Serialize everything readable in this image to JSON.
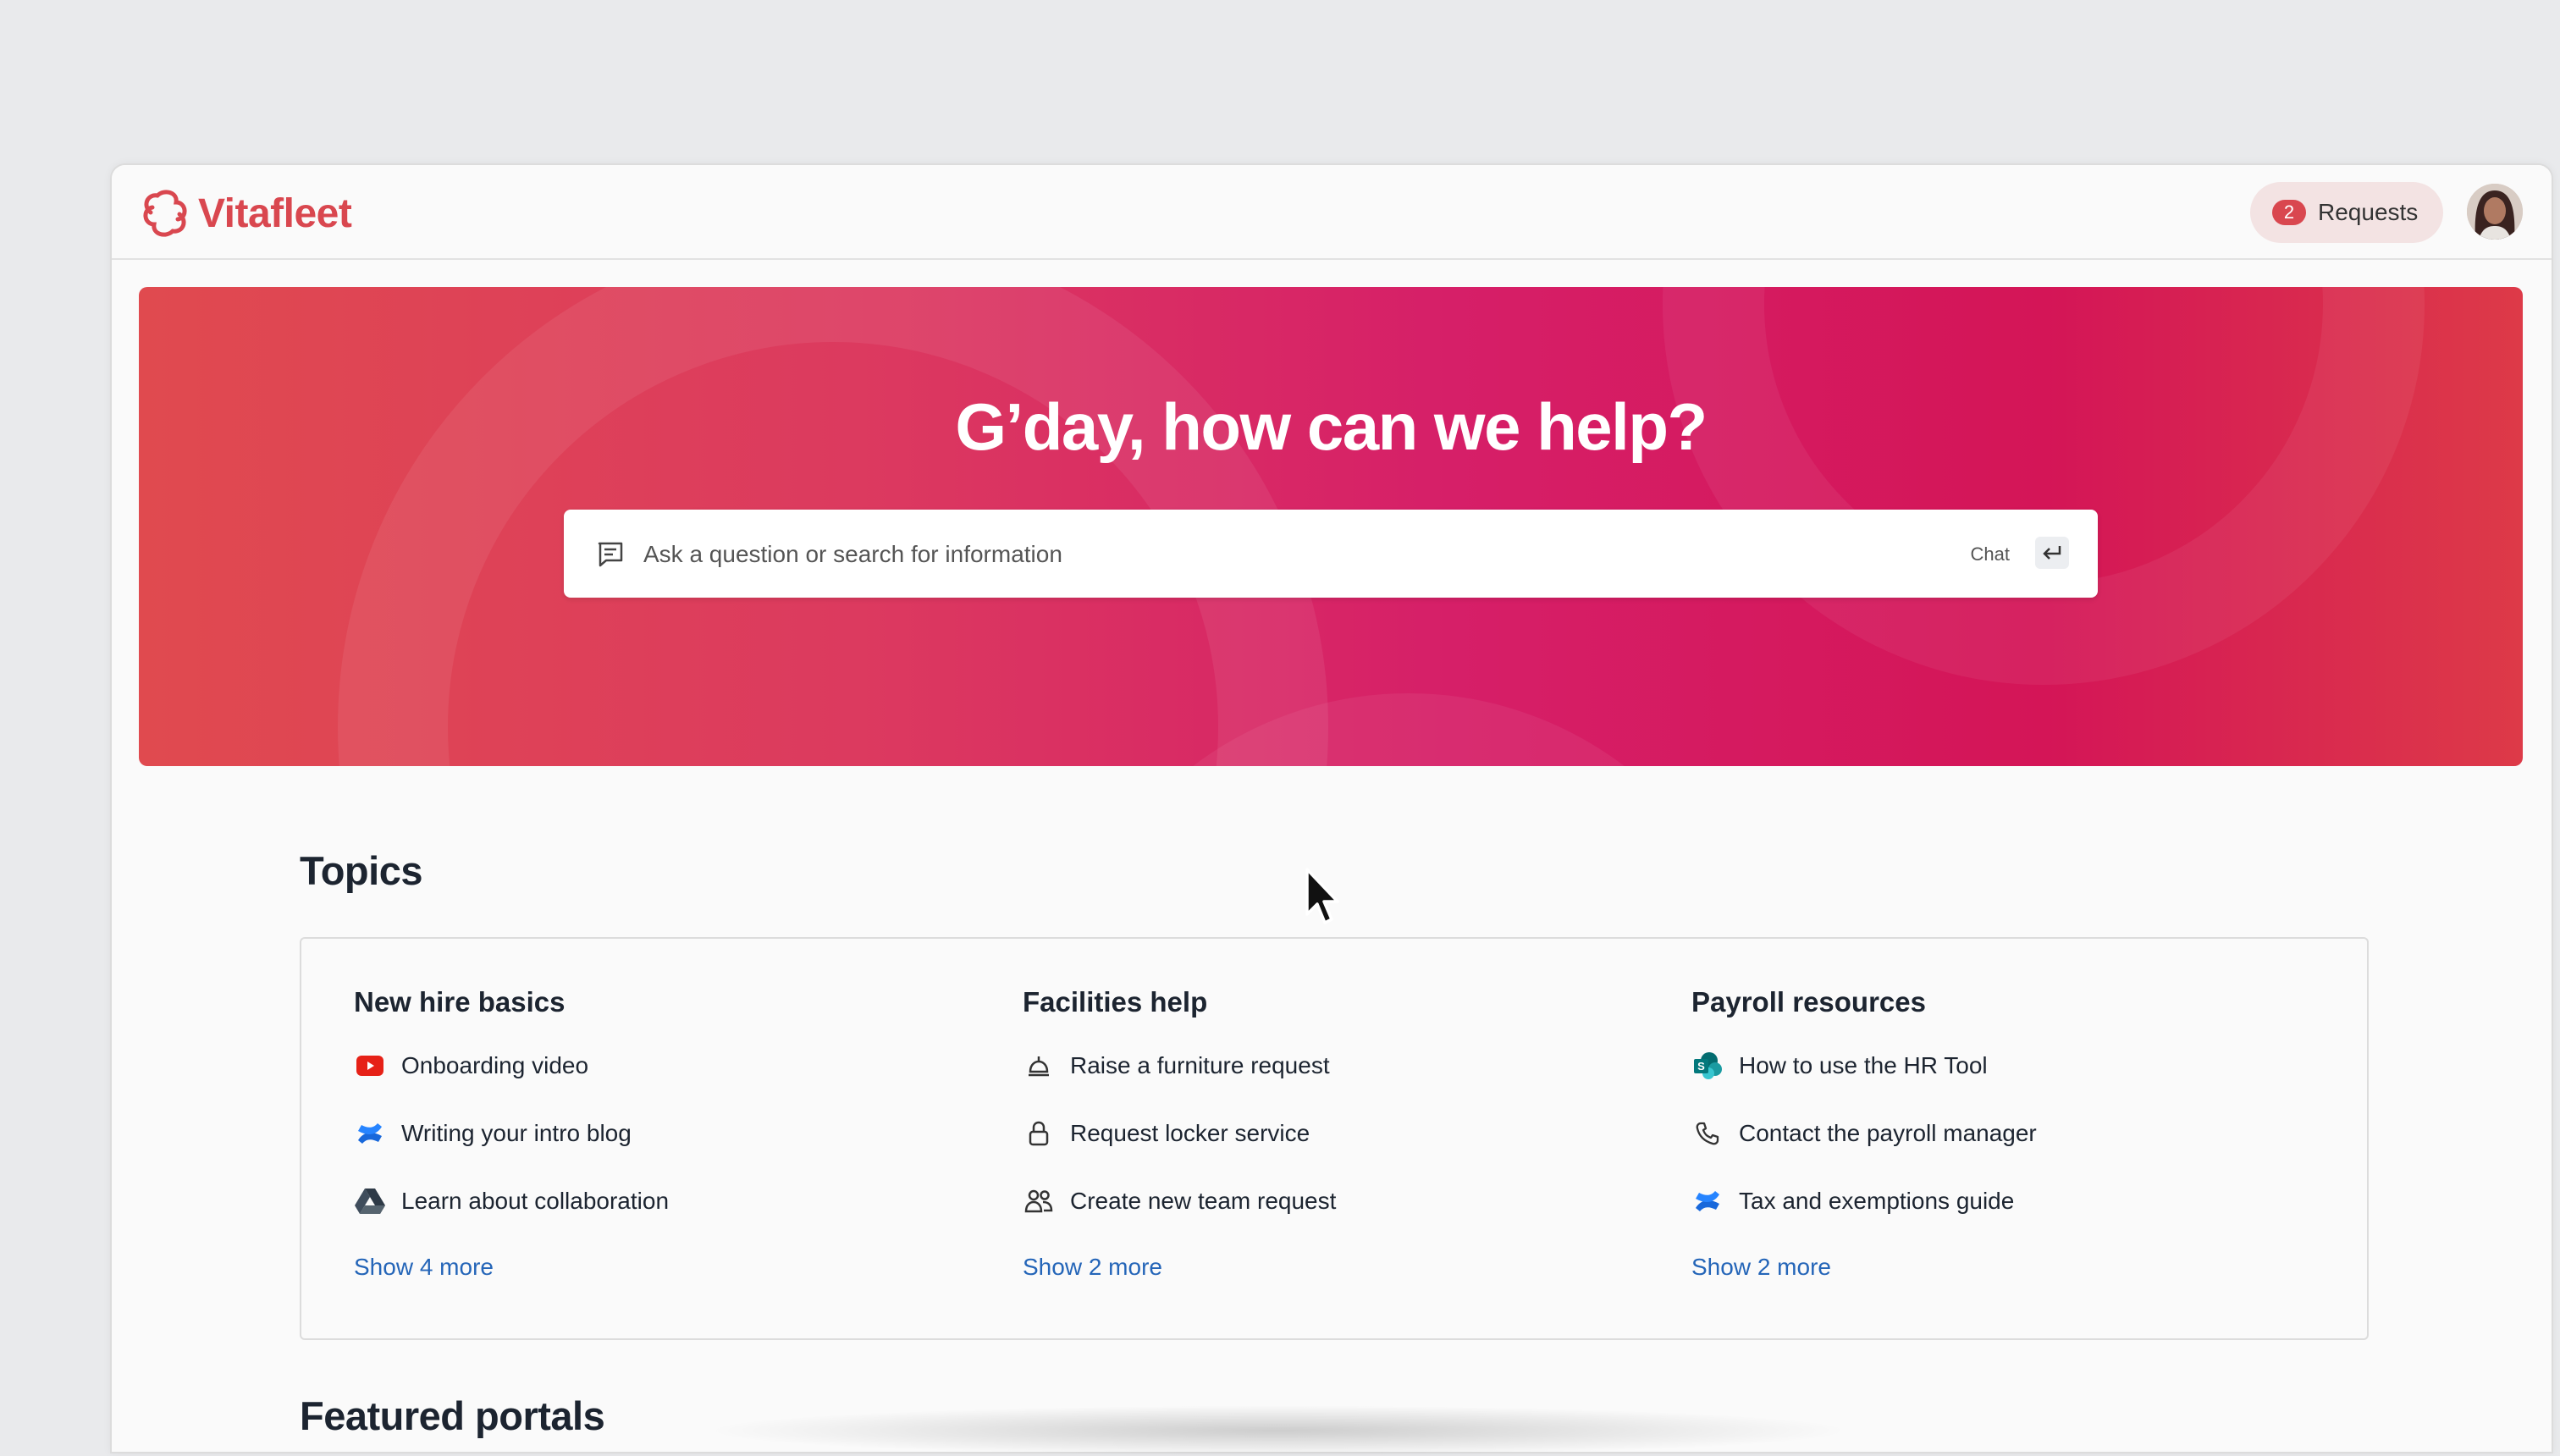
{
  "brand": {
    "name": "Vitafleet",
    "color": "#d9474f",
    "logo_icon": "vitafleet-logo-icon"
  },
  "header": {
    "requests": {
      "count": "2",
      "label": "Requests"
    },
    "avatar_icon": "user-avatar"
  },
  "hero": {
    "title": "G’day, how can we help?",
    "search": {
      "placeholder": "Ask a question or search for information",
      "value": "",
      "chat_label": "Chat",
      "enter_icon": "enter-key-icon"
    },
    "gradient": [
      "#e04a4f",
      "#d61f68",
      "#d41557"
    ]
  },
  "topics": {
    "title": "Topics",
    "columns": [
      {
        "heading": "New hire basics",
        "items": [
          {
            "label": "Onboarding video",
            "icon": "youtube-icon"
          },
          {
            "label": "Writing your intro blog",
            "icon": "confluence-icon"
          },
          {
            "label": "Learn about collaboration",
            "icon": "google-drive-icon"
          }
        ],
        "more": "Show 4 more"
      },
      {
        "heading": "Facilities help",
        "items": [
          {
            "label": "Raise a furniture request",
            "icon": "service-bell-icon"
          },
          {
            "label": "Request locker service",
            "icon": "lock-icon"
          },
          {
            "label": "Create new team request",
            "icon": "people-icon"
          }
        ],
        "more": "Show 2 more"
      },
      {
        "heading": "Payroll resources",
        "items": [
          {
            "label": "How to use the HR Tool",
            "icon": "sharepoint-icon"
          },
          {
            "label": "Contact the payroll manager",
            "icon": "phone-icon"
          },
          {
            "label": "Tax and exemptions guide",
            "icon": "confluence-icon"
          }
        ],
        "more": "Show 2 more"
      }
    ]
  },
  "featured": {
    "title": "Featured portals"
  },
  "colors": {
    "link": "#2465b8",
    "text": "#1c2430"
  }
}
